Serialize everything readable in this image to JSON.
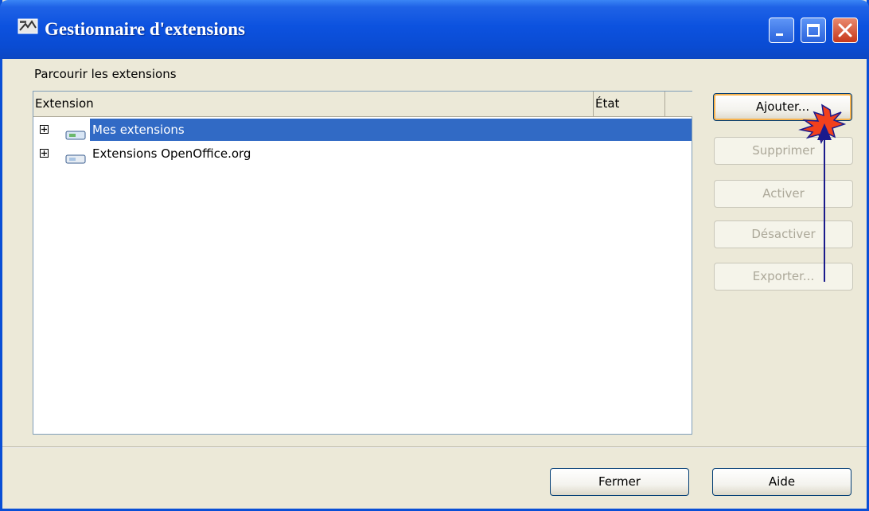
{
  "window": {
    "title": "Gestionnaire d'extensions"
  },
  "browse_label": "Parcourir les extensions",
  "columns": {
    "extension": "Extension",
    "state": "État"
  },
  "items": [
    {
      "label": "Mes extensions",
      "selected": true
    },
    {
      "label": "Extensions OpenOffice.org",
      "selected": false
    }
  ],
  "buttons": {
    "add": "Ajouter...",
    "remove": "Supprimer",
    "enable": "Activer",
    "disable": "Désactiver",
    "export": "Exporter...",
    "close": "Fermer",
    "help": "Aide"
  },
  "icons": {
    "app": "app-icon",
    "minimize": "minimize-icon",
    "maximize": "maximize-icon",
    "close": "close-icon",
    "tree": "package-icon"
  },
  "colors": {
    "title_bar": "#0c52df",
    "selection": "#316ac5",
    "annotation_arrow": "#1a1a8c",
    "annotation_burst": "#f2401c"
  }
}
